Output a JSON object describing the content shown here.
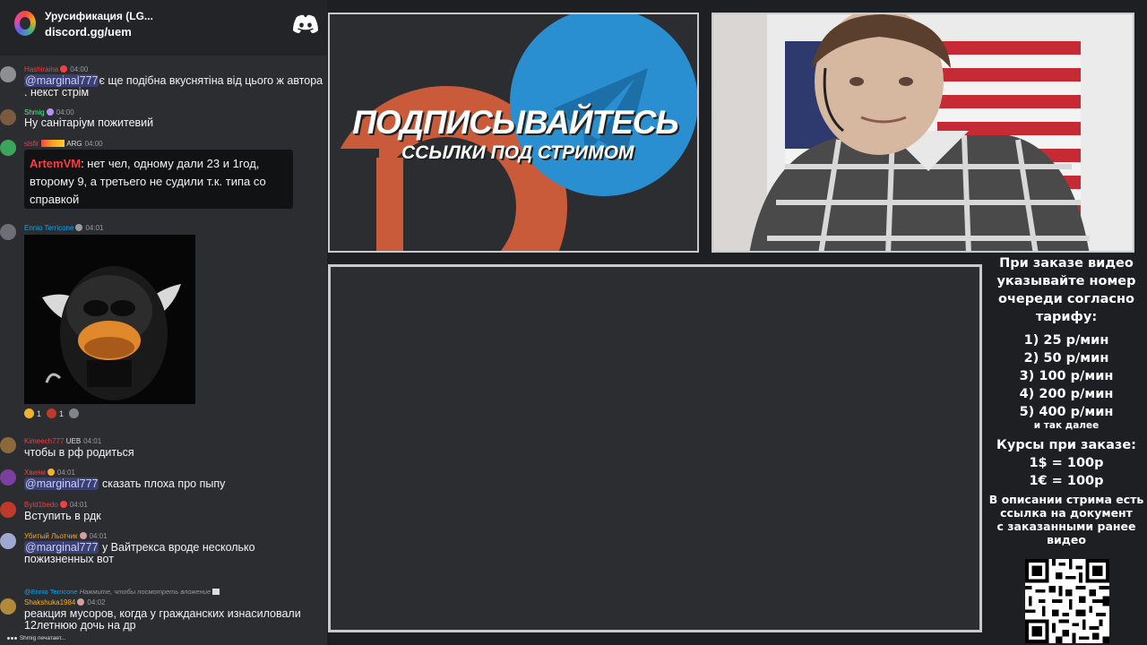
{
  "server": {
    "name": "Урусификация (LG...",
    "invite": "discord.gg/uem"
  },
  "messages": [
    {
      "author": "Hashiraina",
      "time": "04:00",
      "mention": "@marginal777",
      "text": "є ще подібна вкуснятіна від цього ж автора . некст стрім",
      "author_color": "#f23f43"
    },
    {
      "author": "Shmig",
      "time": "04:00",
      "text": "Ну санітаріум пожитевий",
      "author_color": "#57f287"
    },
    {
      "author": "slsfir",
      "badge_text": "ARG",
      "time": "04:00",
      "author_color": "#f23f43",
      "quote_author": "ArtemVM",
      "quote_text": ": нет чел, одному дали 23 и 1год, второму 9, а третьего не судили т.к. типа со справкой"
    },
    {
      "author": "Ennio Terricone",
      "time": "04:01",
      "author_color": "#00a8fc",
      "reactions": [
        "1",
        "1"
      ]
    },
    {
      "author": "Kimeech777",
      "badge_text": "UEB",
      "time": "04:01",
      "text": "чтобы в рф родиться",
      "author_color": "#f23f43"
    },
    {
      "author": "Хвиям",
      "time": "04:01",
      "mention": "@marginal777",
      "text": " сказать плоха про пыпу",
      "author_color": "#ed4245"
    },
    {
      "author": "Byld1bedo",
      "time": "04:01",
      "text": "Вступить в рдк",
      "author_color": "#f23f43"
    },
    {
      "author": "Убитый Льотчик",
      "time": "04:01",
      "mention": "@marginal777",
      "text": " у Вайтрекса вроде несколько пожизненных вот",
      "author_color": "#faa61a"
    },
    {
      "reply_to": "@Ennio Terricone",
      "reply_hint": "Нажмите, чтобы посмотреть вложение",
      "author": "Shakshuka1984",
      "time": "04:02",
      "text": "реакция мусоров, когда у гражданских изнасиловали 12летнюю дочь на др",
      "author_color": "#f0b232"
    }
  ],
  "typing": "Shmig печатает...",
  "banner": {
    "title": "ПОДПИСЫВАЙТЕСЬ",
    "subtitle": "ССЫЛКИ ПОД СТРИМОМ"
  },
  "info": {
    "order_note": [
      "При заказе видео",
      "указывайте номер",
      "очереди согласно",
      "тарифу:"
    ],
    "tariffs": [
      "1) 25 р/мин",
      "2) 50 р/мин",
      "3) 100 р/мин",
      "4) 200 р/мин",
      "5) 400 р/мин"
    ],
    "etc": "и так далее",
    "rates_title": "Курсы при заказе:",
    "rates": [
      "1$ = 100р",
      "1€ = 100р"
    ],
    "description": [
      "В описании стрима есть",
      "ссылка на документ",
      "с заказанными ранее",
      "видео"
    ]
  }
}
